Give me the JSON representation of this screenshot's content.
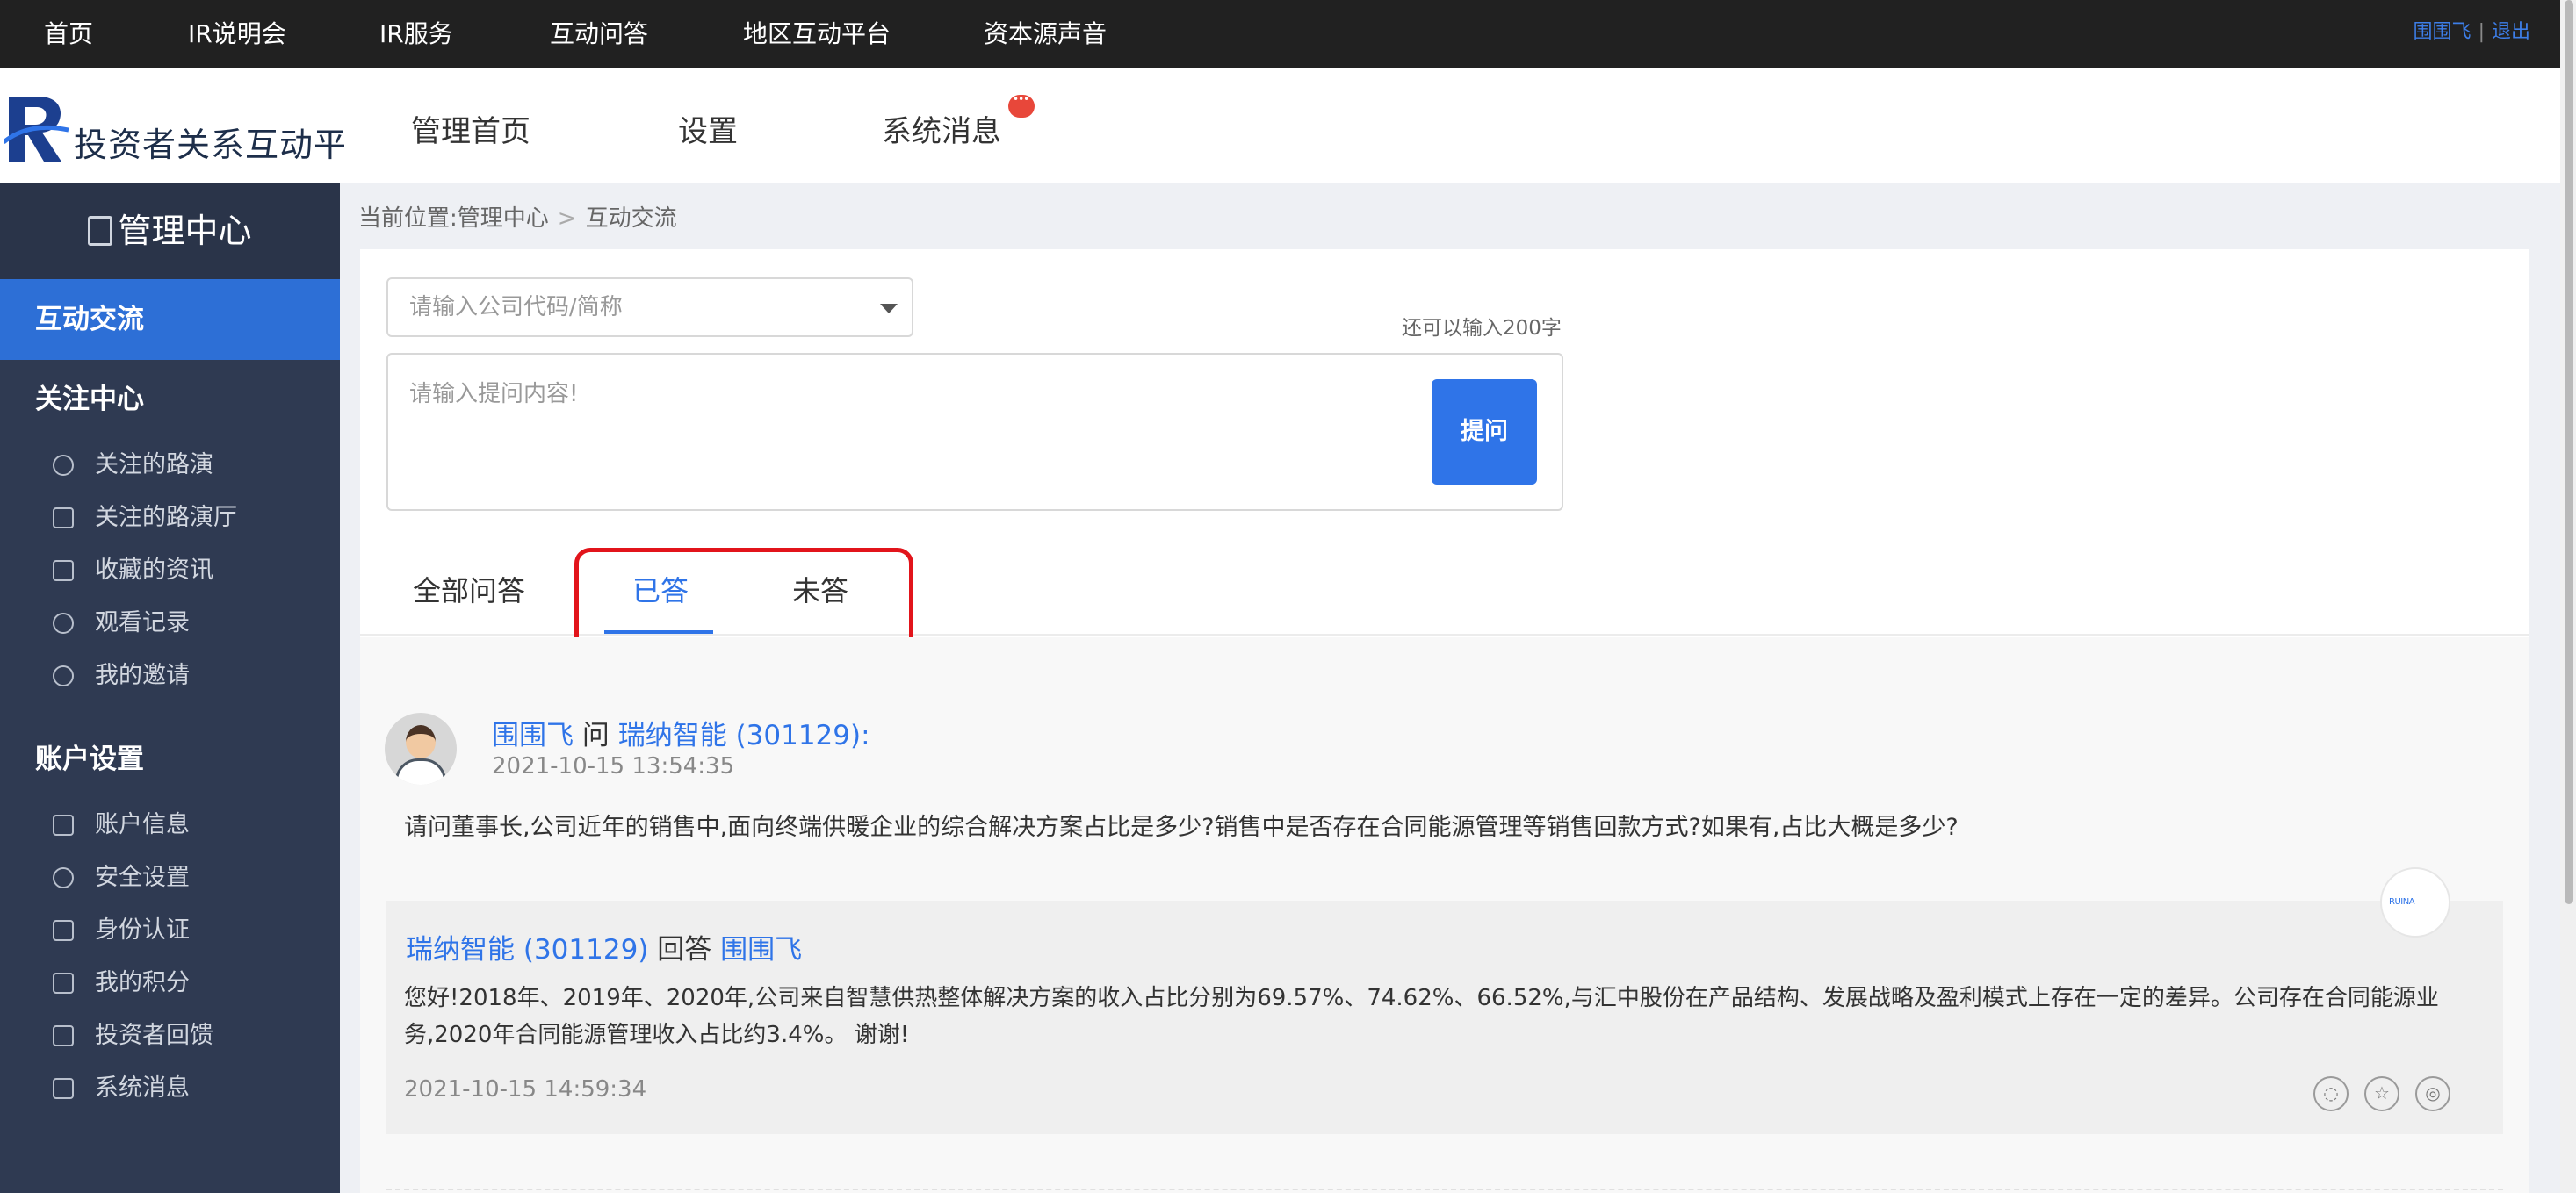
{
  "topnav": {
    "items": [
      "首页",
      "IR说明会",
      "IR服务",
      "互动问答",
      "地区互动平台",
      "资本源声音"
    ],
    "user": "围围飞",
    "separator": "|",
    "logout": "退出"
  },
  "header": {
    "logo_text": "投资者关系互动平",
    "nav": [
      "管理首页",
      "设置",
      "系统消息"
    ]
  },
  "sidebar": {
    "title": "管理中心",
    "active": "互动交流",
    "group1": "关注中心",
    "group1_items": [
      "关注的路演",
      "关注的路演厅",
      "收藏的资讯",
      "观看记录",
      "我的邀请"
    ],
    "group2": "账户设置",
    "group2_items": [
      "账户信息",
      "安全设置",
      "身份认证",
      "我的积分",
      "投资者回馈",
      "系统消息"
    ]
  },
  "breadcrumb": {
    "prefix": "当前位置:",
    "level1": "管理中心",
    "sep": ">",
    "level2": "互动交流"
  },
  "form": {
    "company_placeholder": "请输入公司代码/简称",
    "counter": "还可以输入200字",
    "question_placeholder": "请输入提问内容!",
    "submit_label": "提问"
  },
  "tabs": [
    "全部问答",
    "已答",
    "未答"
  ],
  "question": {
    "asker": "围围飞",
    "ask_word": "问",
    "company": "瑞纳智能 (301129)",
    "colon": ":",
    "time": "2021-10-15 13:54:35",
    "text": "请问董事长,公司近年的销售中,面向终端供暖企业的综合解决方案占比是多少?销售中是否存在合同能源管理等销售回款方式?如果有,占比大概是多少?"
  },
  "answer": {
    "company": "瑞纳智能 (301129)",
    "answer_word": "回答",
    "to": "围围飞",
    "text": "您好!2018年、2019年、2020年,公司来自智慧供热整体解决方案的收入占比分别为69.57%、74.62%、66.52%,与汇中股份在产品结构、发展战略及盈利模式上存在一定的差异。公司存在合同能源业务,2020年合同能源管理收入占比约3.4%。 谢谢!",
    "time": "2021-10-15 14:59:34",
    "logo_text": "RUINA"
  },
  "icons": {
    "share": [
      "wechat-icon",
      "star-icon",
      "weibo-icon"
    ]
  },
  "colors": {
    "accent": "#2f74e8",
    "sidebar": "#2f3a52",
    "active": "#2d6fd6",
    "highlight": "#e2141b"
  }
}
